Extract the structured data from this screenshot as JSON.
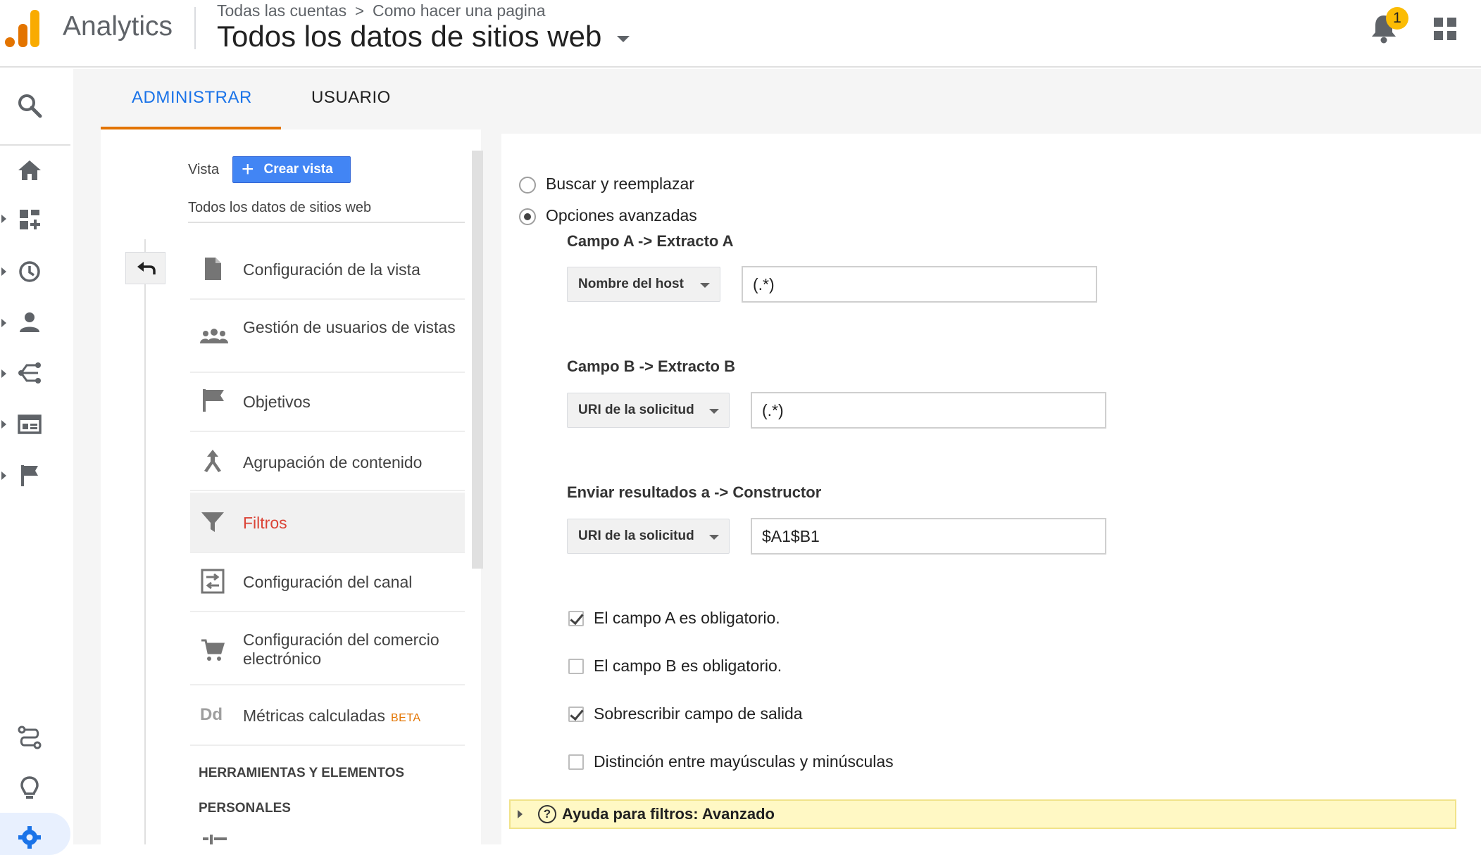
{
  "header": {
    "app_name": "Analytics",
    "breadcrumb_account": "Todas las cuentas",
    "breadcrumb_separator": ">",
    "breadcrumb_property": "Como hacer una pagina",
    "view_title": "Todos los datos de sitios web",
    "notification_count": "1",
    "logo_colors": [
      "#f9ab00",
      "#e37400",
      "#e37400"
    ]
  },
  "tabs": {
    "admin": "ADMINISTRAR",
    "user": "USUARIO"
  },
  "left_panel": {
    "vista_label": "Vista",
    "create_view_button": "Crear vista",
    "view_name": "Todos los datos de sitios web",
    "menu": [
      {
        "label": "Configuración de la vista",
        "icon": "document-icon"
      },
      {
        "label": "Gestión de usuarios de vistas",
        "icon": "people-icon"
      },
      {
        "label": "Objetivos",
        "icon": "flag-icon"
      },
      {
        "label": "Agrupación de contenido",
        "icon": "grouping-icon"
      },
      {
        "label": "Filtros",
        "icon": "filter-icon",
        "active": true
      },
      {
        "label": "Configuración del canal",
        "icon": "channel-icon"
      },
      {
        "label": "Configuración del comercio electrónico",
        "icon": "cart-icon"
      },
      {
        "label": "Métricas calculadas",
        "badge": "BETA",
        "icon": "dd-icon"
      }
    ],
    "dd_icon_text": "Dd",
    "tools_heading_1": "HERRAMIENTAS Y ELEMENTOS",
    "tools_heading_2": "PERSONALES"
  },
  "form": {
    "radio_search_replace": "Buscar y reemplazar",
    "radio_advanced": "Opciones avanzadas",
    "selected_radio": "advanced",
    "field_a": {
      "title": "Campo A -> Extracto A",
      "select": "Nombre del host",
      "value": "(.*)"
    },
    "field_b": {
      "title": "Campo B -> Extracto B",
      "select": "URI de la solicitud",
      "value": "(.*)"
    },
    "output": {
      "title": "Enviar resultados a -> Constructor",
      "select": "URI de la solicitud",
      "value": "$A1$B1"
    },
    "checkboxes": [
      {
        "label": "El campo A es obligatorio.",
        "checked": true
      },
      {
        "label": "El campo B es obligatorio.",
        "checked": false
      },
      {
        "label": "Sobrescribir campo de salida",
        "checked": true
      },
      {
        "label": "Distinción entre mayúsculas y minúsculas",
        "checked": false
      }
    ],
    "help_icon_text": "?",
    "help": "Ayuda para filtros: Avanzado"
  },
  "colors": {
    "accent_blue": "#1a73e8",
    "tab_underline": "#e37400",
    "active_menu_text": "#db4437",
    "create_button": "#4285f4",
    "help_bar": "#fff8c4"
  }
}
